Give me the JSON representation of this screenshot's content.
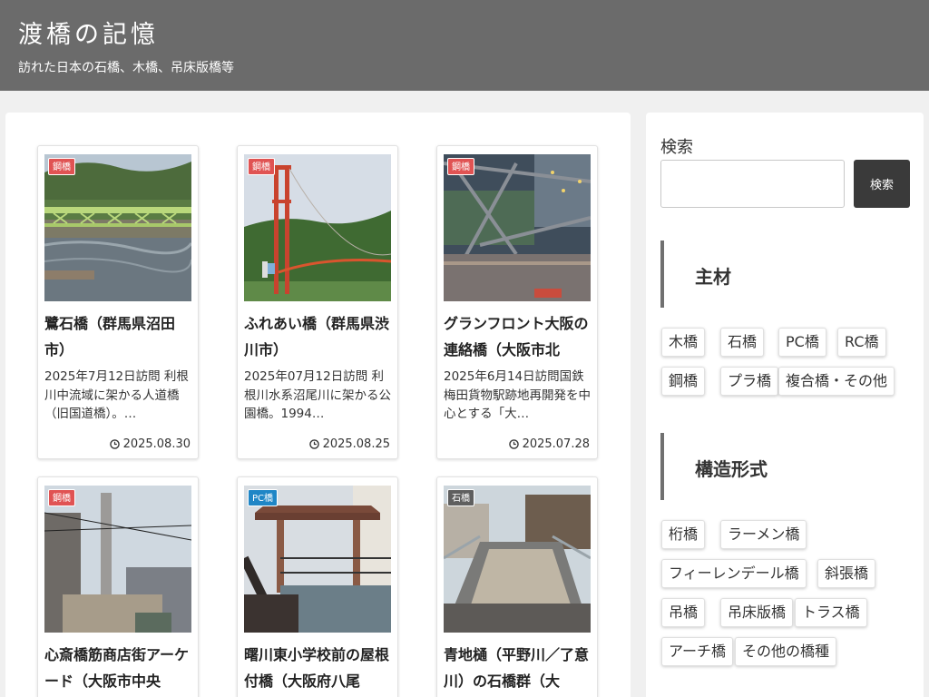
{
  "site": {
    "title": "渡橋の記憶",
    "description": "訪れた日本の石橋、木橋、吊床版橋等"
  },
  "posts": [
    {
      "category": "鋼橋",
      "title": "鷺石橋（群馬県沼田市）",
      "excerpt": "2025年7月12日訪問 利根川中流域に架かる人道橋（旧国道橋）。…",
      "date": "2025.08.30"
    },
    {
      "category": "鋼橋",
      "title": "ふれあい橋（群馬県渋川市）",
      "excerpt": "2025年07月12日訪問 利根川水系沼尾川に架かる公園橋。1994…",
      "date": "2025.08.25"
    },
    {
      "category": "鋼橋",
      "title": "グランフロント大阪の連絡橋（大阪市北",
      "excerpt": "2025年6月14日訪問国鉄梅田貨物駅跡地再開発を中心とする「大…",
      "date": "2025.07.28"
    },
    {
      "category": "鋼橋",
      "title": "心斎橋筋商店街アーケード（大阪市中央"
    },
    {
      "category": "PC橋",
      "title": "曙川東小学校前の屋根付橋（大阪府八尾"
    },
    {
      "category": "石橋",
      "title": "青地樋（平野川／了意川）の石橋群（大"
    }
  ],
  "sidebar": {
    "search": {
      "label": "検索",
      "button": "検索",
      "value": ""
    },
    "materials": {
      "heading": "主材",
      "tags": [
        "木橋",
        "石橋",
        "PC橋",
        "RC橋",
        "鋼橋",
        "プラ橋",
        "複合橋・その他"
      ]
    },
    "structures": {
      "heading": "構造形式",
      "tags": [
        "桁橋",
        "ラーメン橋",
        "フィーレンデール橋",
        "斜張橋",
        "吊橋",
        "吊床版橋",
        "トラス橋",
        "アーチ橋",
        "その他の橋種"
      ]
    }
  },
  "colors": {
    "header_bg": "#6b6b6b",
    "steel_badge": "#e05353",
    "pc_badge": "#1f86c6",
    "stone_badge": "#5f5f5f",
    "search_button": "#3a3a3a"
  },
  "icons": {
    "date": "clock-icon"
  }
}
